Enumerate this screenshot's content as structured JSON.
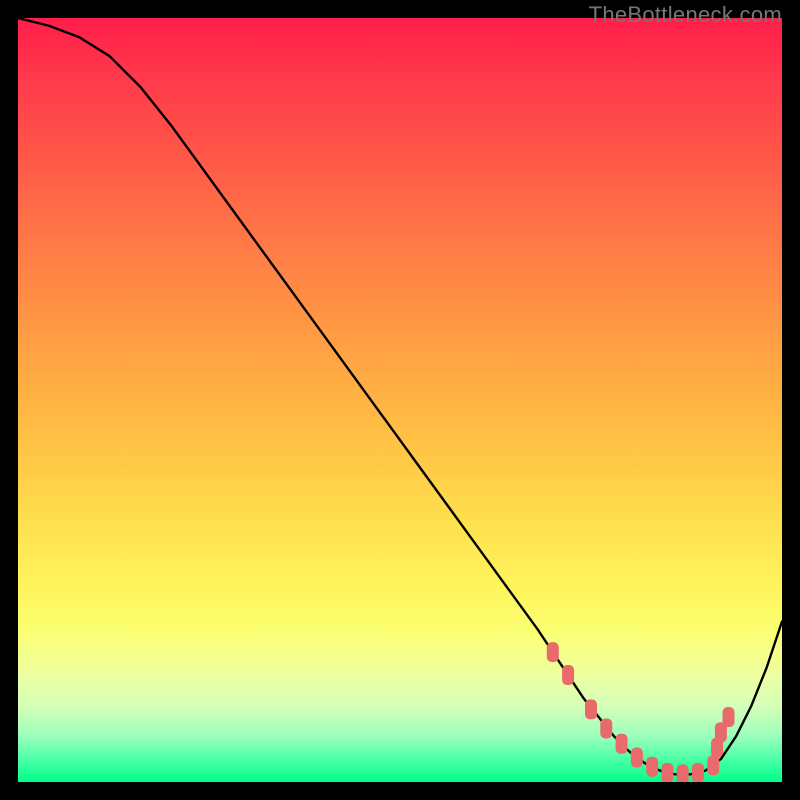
{
  "watermark": "TheBottleneck.com",
  "chart_data": {
    "type": "line",
    "title": "",
    "xlabel": "",
    "ylabel": "",
    "xlim": [
      0,
      100
    ],
    "ylim": [
      0,
      100
    ],
    "grid": false,
    "series": [
      {
        "name": "bottleneck-curve",
        "x": [
          0,
          4,
          8,
          12,
          16,
          20,
          24,
          28,
          32,
          36,
          40,
          44,
          48,
          52,
          56,
          60,
          64,
          68,
          70,
          72,
          74,
          76,
          78,
          80,
          82,
          84,
          86,
          88,
          90,
          92,
          94,
          96,
          98,
          100
        ],
        "y": [
          100,
          99,
          97.5,
          95,
          91,
          86,
          80.5,
          75,
          69.5,
          64,
          58.5,
          53,
          47.5,
          42,
          36.5,
          31,
          25.5,
          20,
          17,
          14,
          11,
          8.5,
          6,
          4,
          2.5,
          1.5,
          1,
          1,
          1.5,
          3,
          6,
          10,
          15,
          21
        ]
      }
    ],
    "markers": {
      "name": "optimal-range",
      "color": "#e86a6a",
      "shape": "rounded-rect",
      "points": [
        {
          "x": 70,
          "y": 17
        },
        {
          "x": 72,
          "y": 14
        },
        {
          "x": 75,
          "y": 9.5
        },
        {
          "x": 77,
          "y": 7
        },
        {
          "x": 79,
          "y": 5
        },
        {
          "x": 81,
          "y": 3.2
        },
        {
          "x": 83,
          "y": 2
        },
        {
          "x": 85,
          "y": 1.2
        },
        {
          "x": 87,
          "y": 1
        },
        {
          "x": 89,
          "y": 1.2
        },
        {
          "x": 91,
          "y": 2.2
        },
        {
          "x": 91.5,
          "y": 4.5
        },
        {
          "x": 92,
          "y": 6.5
        },
        {
          "x": 93,
          "y": 8.5
        }
      ]
    }
  }
}
